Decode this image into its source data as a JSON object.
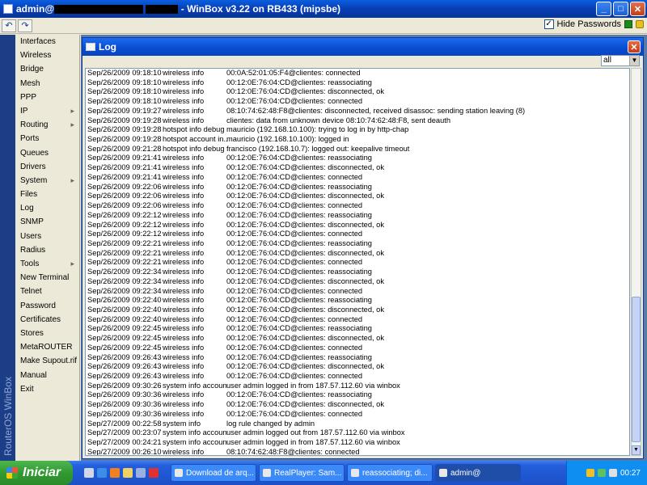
{
  "window": {
    "title_prefix": "admin@",
    "title_suffix": "- WinBox v3.22 on RB433 (mipsbe)",
    "minimize_label": "_",
    "maximize_label": "□",
    "close_label": "✕"
  },
  "toolbar": {
    "undo_label": "↶",
    "redo_label": "↷",
    "hide_passwords_label": "Hide Passwords",
    "hide_passwords_checked": true
  },
  "brand": "RouterOS WinBox",
  "menu": [
    {
      "label": "Interfaces",
      "submenu": false
    },
    {
      "label": "Wireless",
      "submenu": false
    },
    {
      "label": "Bridge",
      "submenu": false
    },
    {
      "label": "Mesh",
      "submenu": false
    },
    {
      "label": "PPP",
      "submenu": false
    },
    {
      "label": "IP",
      "submenu": true
    },
    {
      "label": "Routing",
      "submenu": true
    },
    {
      "label": "Ports",
      "submenu": false
    },
    {
      "label": "Queues",
      "submenu": false
    },
    {
      "label": "Drivers",
      "submenu": false
    },
    {
      "label": "System",
      "submenu": true
    },
    {
      "label": "Files",
      "submenu": false
    },
    {
      "label": "Log",
      "submenu": false
    },
    {
      "label": "SNMP",
      "submenu": false
    },
    {
      "label": "Users",
      "submenu": false
    },
    {
      "label": "Radius",
      "submenu": false
    },
    {
      "label": "Tools",
      "submenu": true
    },
    {
      "label": "New Terminal",
      "submenu": false
    },
    {
      "label": "Telnet",
      "submenu": false
    },
    {
      "label": "Password",
      "submenu": false
    },
    {
      "label": "Certificates",
      "submenu": false
    },
    {
      "label": "Stores",
      "submenu": false
    },
    {
      "label": "MetaROUTER",
      "submenu": false
    },
    {
      "label": "Make Supout.rif",
      "submenu": false
    },
    {
      "label": "Manual",
      "submenu": false
    },
    {
      "label": "Exit",
      "submenu": false
    }
  ],
  "log_window": {
    "title": "Log",
    "close_label": "✕",
    "filter_value": "all",
    "rows": [
      [
        "Sep/26/2009 09:18:10",
        "wireless info",
        "00:0A:52:01:05:F4@clientes: connected"
      ],
      [
        "Sep/26/2009 09:18:10",
        "wireless info",
        "00:12:0E:76:04:CD@clientes: reassociating"
      ],
      [
        "Sep/26/2009 09:18:10",
        "wireless info",
        "00:12:0E:76:04:CD@clientes: disconnected, ok"
      ],
      [
        "Sep/26/2009 09:18:10",
        "wireless info",
        "00:12:0E:76:04:CD@clientes: connected"
      ],
      [
        "Sep/26/2009 09:19:27",
        "wireless info",
        "08:10:74:62:48:F8@clientes: disconnected, received disassoc: sending station leaving (8)"
      ],
      [
        "Sep/26/2009 09:19:28",
        "wireless info",
        "clientes: data from unknown device 08:10:74:62:48:F8, sent deauth"
      ],
      [
        "Sep/26/2009 09:19:28",
        "hotspot info debug",
        "mauricio (192.168.10.100): trying to log in by http-chap"
      ],
      [
        "Sep/26/2009 09:19:28",
        "hotspot account in...",
        "mauricio (192.168.10.100): logged in"
      ],
      [
        "Sep/26/2009 09:21:28",
        "hotspot info debug",
        "francisco (192.168.10.7): logged out: keepalive timeout"
      ],
      [
        "Sep/26/2009 09:21:41",
        "wireless info",
        "00:12:0E:76:04:CD@clientes: reassociating"
      ],
      [
        "Sep/26/2009 09:21:41",
        "wireless info",
        "00:12:0E:76:04:CD@clientes: disconnected, ok"
      ],
      [
        "Sep/26/2009 09:21:41",
        "wireless info",
        "00:12:0E:76:04:CD@clientes: connected"
      ],
      [
        "Sep/26/2009 09:22:06",
        "wireless info",
        "00:12:0E:76:04:CD@clientes: reassociating"
      ],
      [
        "Sep/26/2009 09:22:06",
        "wireless info",
        "00:12:0E:76:04:CD@clientes: disconnected, ok"
      ],
      [
        "Sep/26/2009 09:22:06",
        "wireless info",
        "00:12:0E:76:04:CD@clientes: connected"
      ],
      [
        "Sep/26/2009 09:22:12",
        "wireless info",
        "00:12:0E:76:04:CD@clientes: reassociating"
      ],
      [
        "Sep/26/2009 09:22:12",
        "wireless info",
        "00:12:0E:76:04:CD@clientes: disconnected, ok"
      ],
      [
        "Sep/26/2009 09:22:12",
        "wireless info",
        "00:12:0E:76:04:CD@clientes: connected"
      ],
      [
        "Sep/26/2009 09:22:21",
        "wireless info",
        "00:12:0E:76:04:CD@clientes: reassociating"
      ],
      [
        "Sep/26/2009 09:22:21",
        "wireless info",
        "00:12:0E:76:04:CD@clientes: disconnected, ok"
      ],
      [
        "Sep/26/2009 09:22:21",
        "wireless info",
        "00:12:0E:76:04:CD@clientes: connected"
      ],
      [
        "Sep/26/2009 09:22:34",
        "wireless info",
        "00:12:0E:76:04:CD@clientes: reassociating"
      ],
      [
        "Sep/26/2009 09:22:34",
        "wireless info",
        "00:12:0E:76:04:CD@clientes: disconnected, ok"
      ],
      [
        "Sep/26/2009 09:22:34",
        "wireless info",
        "00:12:0E:76:04:CD@clientes: connected"
      ],
      [
        "Sep/26/2009 09:22:40",
        "wireless info",
        "00:12:0E:76:04:CD@clientes: reassociating"
      ],
      [
        "Sep/26/2009 09:22:40",
        "wireless info",
        "00:12:0E:76:04:CD@clientes: disconnected, ok"
      ],
      [
        "Sep/26/2009 09:22:40",
        "wireless info",
        "00:12:0E:76:04:CD@clientes: connected"
      ],
      [
        "Sep/26/2009 09:22:45",
        "wireless info",
        "00:12:0E:76:04:CD@clientes: reassociating"
      ],
      [
        "Sep/26/2009 09:22:45",
        "wireless info",
        "00:12:0E:76:04:CD@clientes: disconnected, ok"
      ],
      [
        "Sep/26/2009 09:22:45",
        "wireless info",
        "00:12:0E:76:04:CD@clientes: connected"
      ],
      [
        "Sep/26/2009 09:26:43",
        "wireless info",
        "00:12:0E:76:04:CD@clientes: reassociating"
      ],
      [
        "Sep/26/2009 09:26:43",
        "wireless info",
        "00:12:0E:76:04:CD@clientes: disconnected, ok"
      ],
      [
        "Sep/26/2009 09:26:43",
        "wireless info",
        "00:12:0E:76:04:CD@clientes: connected"
      ],
      [
        "Sep/26/2009 09:30:26",
        "system info account",
        "user admin logged in from 187.57.112.60 via winbox"
      ],
      [
        "Sep/26/2009 09:30:36",
        "wireless info",
        "00:12:0E:76:04:CD@clientes: reassociating"
      ],
      [
        "Sep/26/2009 09:30:36",
        "wireless info",
        "00:12:0E:76:04:CD@clientes: disconnected, ok"
      ],
      [
        "Sep/26/2009 09:30:36",
        "wireless info",
        "00:12:0E:76:04:CD@clientes: connected"
      ],
      [
        "Sep/27/2009 00:22:58",
        "system info",
        "log rule changed by admin"
      ],
      [
        "Sep/27/2009 00:23:07",
        "system info account",
        "user admin logged out from 187.57.112.60 via winbox"
      ],
      [
        "Sep/27/2009 00:24:21",
        "system info account",
        "user admin logged in from 187.57.112.60 via winbox"
      ],
      [
        "Sep/27/2009 00:26:10",
        "wireless info",
        "08:10:74:62:48:F8@clientes: connected"
      ]
    ]
  },
  "taskbar": {
    "start_label": "Iniciar",
    "tasks": [
      {
        "label": "Download de arq...",
        "active": false
      },
      {
        "label": "RealPlayer: Sam...",
        "active": false
      },
      {
        "label": "reassociating; di...",
        "active": false
      },
      {
        "label": "admin@",
        "active": true
      }
    ],
    "clock": "00:27"
  },
  "colors": {
    "title_blue": "#0a4fd4",
    "brand_strip": "#1c3e86",
    "start_green": "#329a32"
  }
}
